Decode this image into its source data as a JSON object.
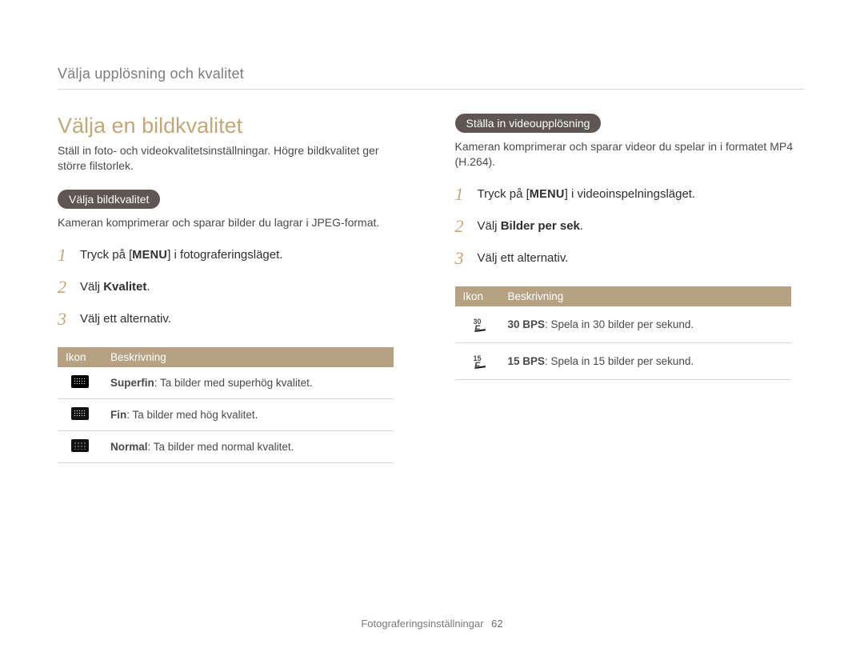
{
  "breadcrumb": "Välja upplösning och kvalitet",
  "title": "Välja en bildkvalitet",
  "intro": "Ställ in foto- och videokvalitetsinställningar. Högre bildkvalitet ger större filstorlek.",
  "left": {
    "pill": "Välja bildkvalitet",
    "para": "Kameran komprimerar och sparar bilder du lagrar i JPEG-format.",
    "steps": {
      "s1_pre": "Tryck på [",
      "s1_menu": "MENU",
      "s1_post": "] i fotograferingsläget.",
      "s2_pre": "Välj ",
      "s2_bold": "Kvalitet",
      "s2_post": ".",
      "s3": "Välj ett alternativ."
    },
    "table": {
      "h_icon": "Ikon",
      "h_desc": "Beskrivning",
      "rows": [
        {
          "bold": "Superfin",
          "rest": ": Ta bilder med superhög kvalitet."
        },
        {
          "bold": "Fin",
          "rest": ": Ta bilder med hög kvalitet."
        },
        {
          "bold": "Normal",
          "rest": ": Ta bilder med normal kvalitet."
        }
      ]
    }
  },
  "right": {
    "pill": "Ställa in videoupplösning",
    "para": "Kameran komprimerar och sparar videor du spelar in i formatet MP4 (H.264).",
    "steps": {
      "s1_pre": "Tryck på [",
      "s1_menu": "MENU",
      "s1_post": "] i videoinspelningsläget.",
      "s2_pre": "Välj ",
      "s2_bold": "Bilder per sek",
      "s2_post": ".",
      "s3": "Välj ett alternativ."
    },
    "table": {
      "h_icon": "Ikon",
      "h_desc": "Beskrivning",
      "rows": [
        {
          "fps": "30",
          "bold": "30 BPS",
          "rest": ": Spela in 30 bilder per sekund."
        },
        {
          "fps": "15",
          "bold": "15 BPS",
          "rest": ": Spela in 15 bilder per sekund."
        }
      ]
    }
  },
  "footer": {
    "section": "Fotograferingsinställningar",
    "page": "62"
  },
  "nums": {
    "n1": "1",
    "n2": "2",
    "n3": "3"
  }
}
